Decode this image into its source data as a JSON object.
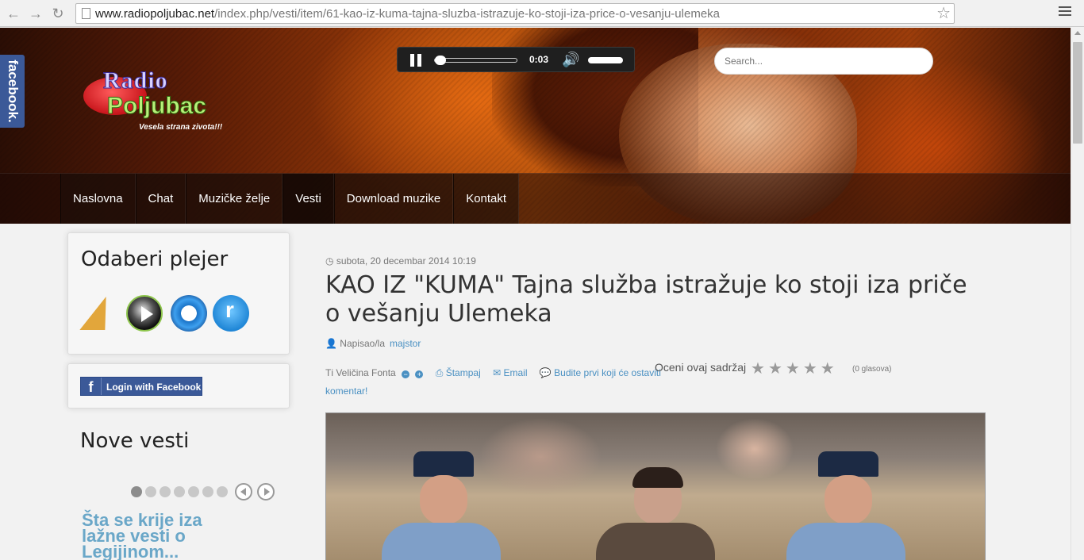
{
  "browser": {
    "url_domain": "www.radiopoljubac.net",
    "url_path": "/index.php/vesti/item/61-kao-iz-kuma-tajna-sluzba-istrazuje-ko-stoji-iza-price-o-vesanju-ulemeka"
  },
  "header": {
    "logo": {
      "line1": "Radio",
      "line2": "Poljubac",
      "tagline": "Vesela strana zivota!!!"
    },
    "player": {
      "time": "0:03",
      "progress": 0.0,
      "volume": 1.0
    },
    "search": {
      "placeholder": "Search..."
    },
    "menu": [
      {
        "label": "Naslovna"
      },
      {
        "label": "Chat"
      },
      {
        "label": "Muzičke želje"
      },
      {
        "label": "Vesti",
        "active": true
      },
      {
        "label": "Download muzike"
      },
      {
        "label": "Kontakt"
      }
    ],
    "facebook_tab": "facebook."
  },
  "sidebar": {
    "player_select": {
      "title": "Odaberi plejer",
      "players": [
        "winamp-icon",
        "windows-media-player-icon",
        "quicktime-icon",
        "realplayer-icon"
      ]
    },
    "facebook_login": {
      "label": "Login with Facebook",
      "icon": "f"
    },
    "news": {
      "title": "Nove vesti",
      "dot_count": 7,
      "active_dot": 0,
      "current_title": "Šta se krije iza lažne vesti o Legijinom..."
    }
  },
  "article": {
    "date": "subota, 20 decembar 2014 10:19",
    "title": "KAO IZ \"KUMA\" Tajna služba istražuje ko stoji iza priče o vešanju Ulemeka",
    "author_label": "Napisao/la",
    "author": "majstor",
    "tools": {
      "font_size": "Veličina Fonta",
      "print": "Štampaj",
      "email": "Email",
      "comment": "Budite prvi koji će ostaviti komentar!"
    },
    "rating": {
      "label": "Oceni ovaj sadržaj",
      "stars": 5,
      "votes": "(0 glasova)",
      "value": 0
    }
  },
  "colors": {
    "link": "#4a90c2",
    "facebook": "#3b5998",
    "slide_title": "#6aa7c8"
  }
}
